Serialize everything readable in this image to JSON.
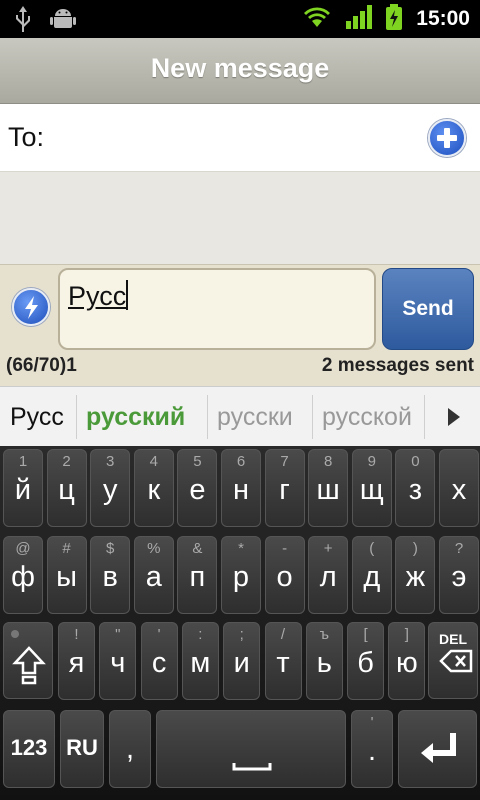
{
  "status_bar": {
    "icons": [
      "usb-icon",
      "android-debug-icon",
      "wifi-icon",
      "signal-icon",
      "battery-charging-icon"
    ],
    "time": "15:00"
  },
  "title": "New message",
  "to": {
    "label": "To:",
    "add_icon": "add-contact-icon"
  },
  "compose": {
    "text": "Русс",
    "char_counter": "(66/70)1",
    "sent_status": "2 messages sent",
    "send_label": "Send",
    "attach_icon": "lightning-icon"
  },
  "suggestions": {
    "items": [
      "Русс",
      "русский",
      "русски",
      "русской"
    ],
    "selected_index": 1,
    "colors": {
      "typed": "#111111",
      "selected": "#4b9a3a",
      "other": "#999999"
    }
  },
  "keyboard": {
    "row1": [
      {
        "hint": "1",
        "main": "й"
      },
      {
        "hint": "2",
        "main": "ц"
      },
      {
        "hint": "3",
        "main": "у"
      },
      {
        "hint": "4",
        "main": "к"
      },
      {
        "hint": "5",
        "main": "е"
      },
      {
        "hint": "6",
        "main": "н"
      },
      {
        "hint": "7",
        "main": "г"
      },
      {
        "hint": "8",
        "main": "ш"
      },
      {
        "hint": "9",
        "main": "щ"
      },
      {
        "hint": "0",
        "main": "з"
      },
      {
        "hint": "",
        "main": "х"
      }
    ],
    "row2": [
      {
        "hint": "@",
        "main": "ф"
      },
      {
        "hint": "#",
        "main": "ы"
      },
      {
        "hint": "$",
        "main": "в"
      },
      {
        "hint": "%",
        "main": "а"
      },
      {
        "hint": "&",
        "main": "п"
      },
      {
        "hint": "*",
        "main": "р"
      },
      {
        "hint": "-",
        "main": "о"
      },
      {
        "hint": "+",
        "main": "л"
      },
      {
        "hint": "(",
        "main": "д"
      },
      {
        "hint": ")",
        "main": "ж"
      },
      {
        "hint": "?",
        "main": "э"
      }
    ],
    "row3": [
      {
        "hint": "!",
        "main": "я"
      },
      {
        "hint": "\"",
        "main": "ч"
      },
      {
        "hint": "'",
        "main": "с"
      },
      {
        "hint": ":",
        "main": "м"
      },
      {
        "hint": ";",
        "main": "и"
      },
      {
        "hint": "/",
        "main": "т"
      },
      {
        "hint": "ъ",
        "main": "ь"
      },
      {
        "hint": "[",
        "main": "б"
      },
      {
        "hint": "]",
        "main": "ю"
      }
    ],
    "shift_icon": "shift-icon",
    "delete_label": "DEL",
    "delete_icon": "backspace-icon",
    "row4": {
      "numbers": "123",
      "lang": "RU",
      "comma": ",",
      "dot": ".",
      "dot_hint": "'",
      "enter_icon": "enter-icon"
    }
  }
}
